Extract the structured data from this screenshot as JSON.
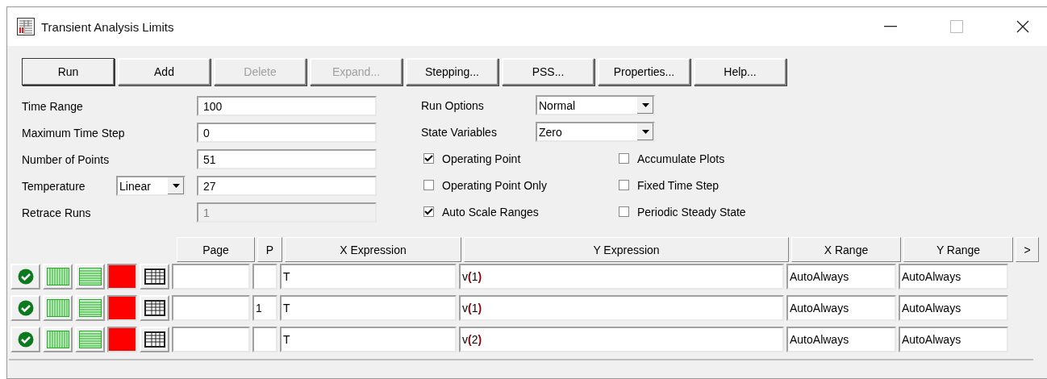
{
  "window": {
    "title": "Transient Analysis Limits"
  },
  "buttons": [
    {
      "label": "Run",
      "disabled": false,
      "default": true
    },
    {
      "label": "Add",
      "disabled": false,
      "default": false
    },
    {
      "label": "Delete",
      "disabled": true,
      "default": false
    },
    {
      "label": "Expand...",
      "disabled": true,
      "default": false
    },
    {
      "label": "Stepping...",
      "disabled": false,
      "default": false
    },
    {
      "label": "PSS...",
      "disabled": false,
      "default": false
    },
    {
      "label": "Properties...",
      "disabled": false,
      "default": false
    },
    {
      "label": "Help...",
      "disabled": false,
      "default": false
    }
  ],
  "fields": [
    {
      "label": "Time Range",
      "value": "100",
      "disabled": false
    },
    {
      "label": "Maximum Time Step",
      "value": "0",
      "disabled": false
    },
    {
      "label": "Number of Points",
      "value": "51",
      "disabled": false
    },
    {
      "label": "Temperature",
      "mode": "Linear",
      "value": "27",
      "disabled": false
    },
    {
      "label": "Retrace Runs",
      "value": "1",
      "disabled": true
    }
  ],
  "options": [
    {
      "label": "Run Options",
      "value": "Normal"
    },
    {
      "label": "State Variables",
      "value": "Zero"
    }
  ],
  "checkboxes": [
    {
      "label": "Operating Point",
      "checked": true
    },
    {
      "label": "Operating Point Only",
      "checked": false
    },
    {
      "label": "Auto Scale Ranges",
      "checked": true
    },
    {
      "label": "Accumulate Plots",
      "checked": false
    },
    {
      "label": "Fixed Time Step",
      "checked": false
    },
    {
      "label": "Periodic Steady State",
      "checked": false
    }
  ],
  "table": {
    "columns": [
      "Page",
      "P",
      "X Expression",
      "Y Expression",
      "X Range",
      "Y Range"
    ],
    "more_button": ">",
    "rows": [
      {
        "color": "#ff0000",
        "page": "",
        "p": "",
        "x_expression": "T",
        "y_expression": "v**(**1**)**",
        "x_range": "AutoAlways",
        "y_range": "AutoAlways"
      },
      {
        "color": "#ff0000",
        "page": "",
        "p": "1",
        "x_expression": "T",
        "y_expression": "v**(**1**)**",
        "x_range": "AutoAlways",
        "y_range": "AutoAlways"
      },
      {
        "color": "#ff0000",
        "page": "",
        "p": "",
        "x_expression": "T",
        "y_expression": "v**(**2**)**",
        "x_range": "AutoAlways",
        "y_range": "AutoAlways"
      }
    ]
  }
}
